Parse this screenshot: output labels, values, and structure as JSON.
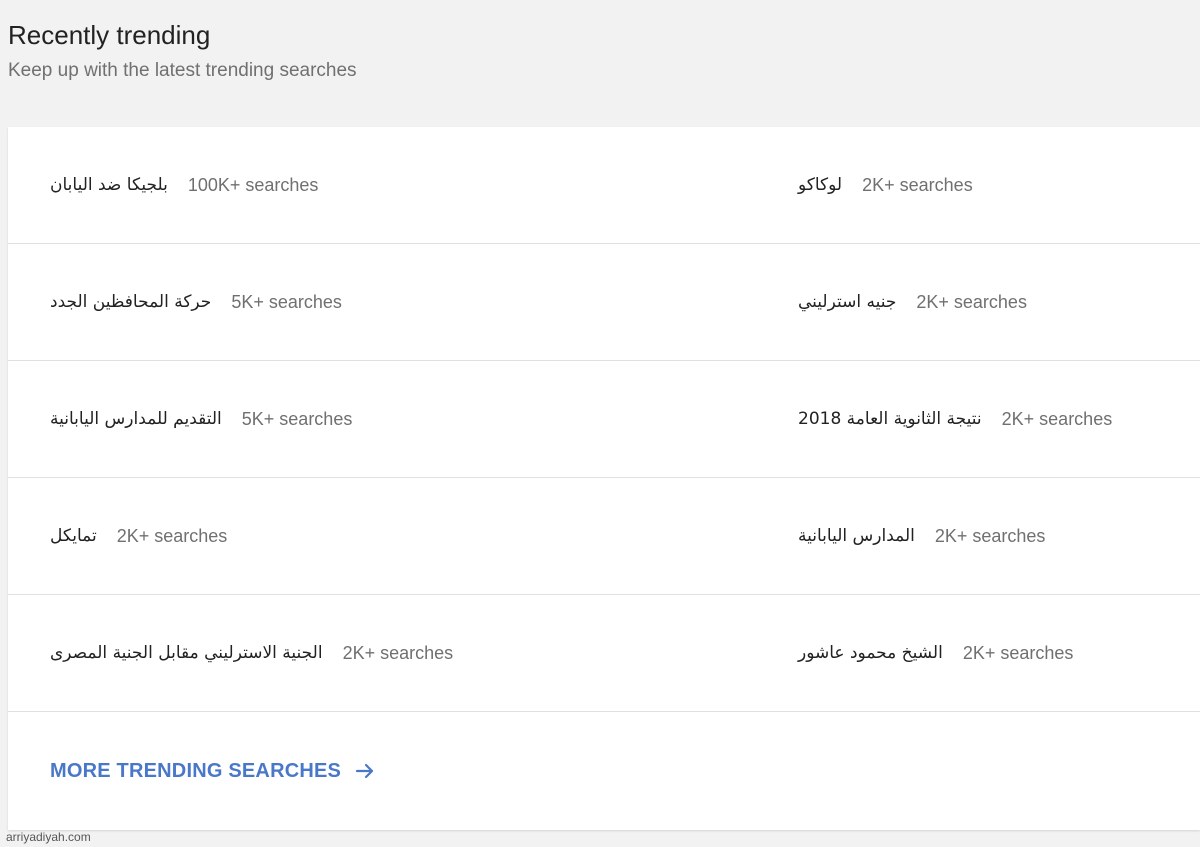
{
  "header": {
    "title": "Recently trending",
    "subtitle": "Keep up with the latest trending searches"
  },
  "trends": [
    {
      "query": "بلجيكا ضد اليابان",
      "count": "100K+ searches"
    },
    {
      "query": "لوكاكو",
      "count": "2K+ searches"
    },
    {
      "query": "حركة المحافظين الجدد",
      "count": "5K+ searches"
    },
    {
      "query": "جنيه استرليني",
      "count": "2K+ searches"
    },
    {
      "query": "التقديم للمدارس اليابانية",
      "count": "5K+ searches"
    },
    {
      "query": "نتيجة الثانوية العامة 2018",
      "count": "2K+ searches"
    },
    {
      "query": "تمايكل",
      "count": "2K+ searches"
    },
    {
      "query": "المدارس اليابانية",
      "count": "2K+ searches"
    },
    {
      "query": "الجنية الاسترليني مقابل الجنية المصرى",
      "count": "2K+ searches"
    },
    {
      "query": "الشيخ محمود عاشور",
      "count": "2K+ searches"
    }
  ],
  "more": {
    "label": "MORE TRENDING SEARCHES",
    "icon": "arrow-right-icon"
  },
  "watermark": "arriyadiyah.com",
  "colors": {
    "accent": "#4a78c8",
    "background": "#f2f2f2",
    "card": "#ffffff",
    "muted_text": "#707070"
  }
}
